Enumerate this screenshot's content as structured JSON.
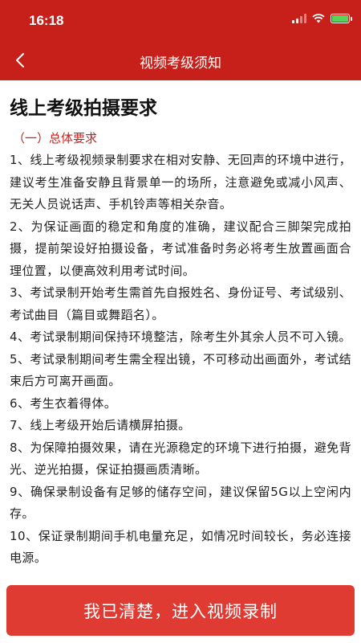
{
  "status_bar": {
    "time": "16:18",
    "icons": [
      "signal-icon",
      "wifi-icon",
      "battery-charging-icon"
    ]
  },
  "nav": {
    "title": "视频考级须知",
    "back_icon": "chevron-left-icon"
  },
  "content": {
    "title": "线上考级拍摄要求",
    "section_heading": "（一）总体要求",
    "items": [
      "1、线上考级视频录制要求在相对安静、无回声的环境中进行，建议考生准备安静且背景单一的场所，注意避免或减小风声、无关人员说话声、手机铃声等相关杂音。",
      "2、为保证画面的稳定和角度的准确，建议配合三脚架完成拍摄，提前架设好拍摄设备，考试准备时务必将考生放置画面合理位置，以便高效利用考试时间。",
      "3、考试录制开始考生需首先自报姓名、身份证号、考试级别、考试曲目（篇目或舞蹈名）。",
      "4、考试录制期间保持环境整洁，除考生外其余人员不可入镜。",
      "5、考试录制期间考生需全程出镜，不可移动出画面外，考试结束后方可离开画面。",
      "6、考生衣着得体。",
      "7、线上考级开始后请横屏拍摄。",
      "8、为保障拍摄效果，请在光源稳定的环境下进行拍摄，避免背光、逆光拍摄，保证拍摄画质清晰。",
      "9、确保录制设备有足够的储存空间，建议保留5G以上空闲内存。",
      "10、保证录制期间手机电量充足，如情况时间较长，务必连接电源。"
    ]
  },
  "footer": {
    "confirm_label": "我已清楚，进入视频录制"
  },
  "colors": {
    "brand_red": "#c7201a",
    "button_red": "#e03b33",
    "heading_red": "#c7201a"
  }
}
